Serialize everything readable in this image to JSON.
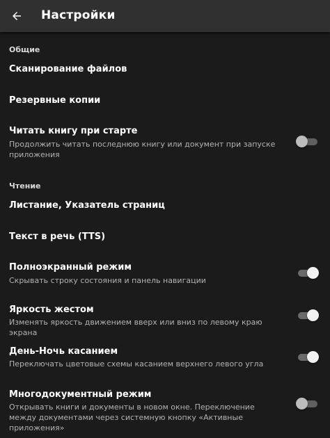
{
  "appbar": {
    "back_icon": "arrow-back-icon",
    "title": "Настройки"
  },
  "sections": {
    "general": {
      "header": "Общие",
      "scan_files": {
        "title": "Сканирование файлов"
      },
      "backups": {
        "title": "Резервные копии"
      },
      "read_on_start": {
        "title": "Читать книгу при старте",
        "summary": "Продолжить читать последнюю книгу или документ при запуске приложения",
        "enabled": false
      }
    },
    "reading": {
      "header": "Чтение",
      "paging": {
        "title": "Листание, Указатель страниц"
      },
      "tts": {
        "title": "Текст в речь (TTS)"
      },
      "fullscreen": {
        "title": "Полноэкранный режим",
        "summary": "Скрывать строку состояния и панель навигации",
        "enabled": true
      },
      "brightness_gesture": {
        "title": "Яркость жестом",
        "summary": "Изменять яркость движением вверх или вниз по левому краю экрана",
        "enabled": true
      },
      "day_night_tap": {
        "title": "День-Ночь касанием",
        "summary": "Переключать цветовые схемы касанием верхнего левого угла",
        "enabled": true
      },
      "multi_document": {
        "title": "Многодокументный режим",
        "summary": "Открывать книги и документы в новом окне. Переключение между документами через системную кнопку «Активные приложения»",
        "enabled": false
      }
    }
  },
  "colors": {
    "background": "#1b1b1b",
    "appbar": "#303030",
    "text_primary": "#ffffff",
    "text_secondary": "#b3b3b3"
  }
}
